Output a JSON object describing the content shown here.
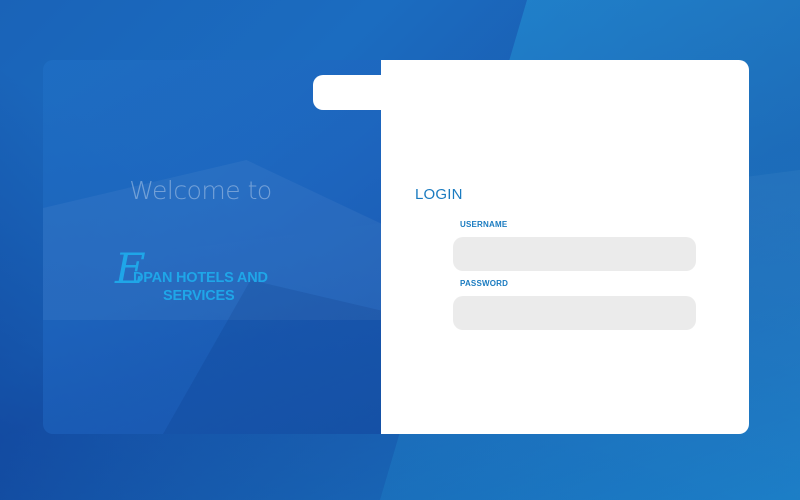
{
  "welcome": {
    "heading": "Welcome to"
  },
  "brand": {
    "logo_letter": "E",
    "name_line1": "DPAN HOTELS AND",
    "name_line2": "SERVICES"
  },
  "login": {
    "title": "LOGIN",
    "username": {
      "label": "USERNAME",
      "value": "",
      "placeholder": ""
    },
    "password": {
      "label": "PASSWORD",
      "value": "",
      "placeholder": ""
    }
  },
  "colors": {
    "accent": "#1a7bc0",
    "brand": "#1fa6e8",
    "field_bg": "#ebebeb",
    "card_bg": "#ffffff"
  }
}
